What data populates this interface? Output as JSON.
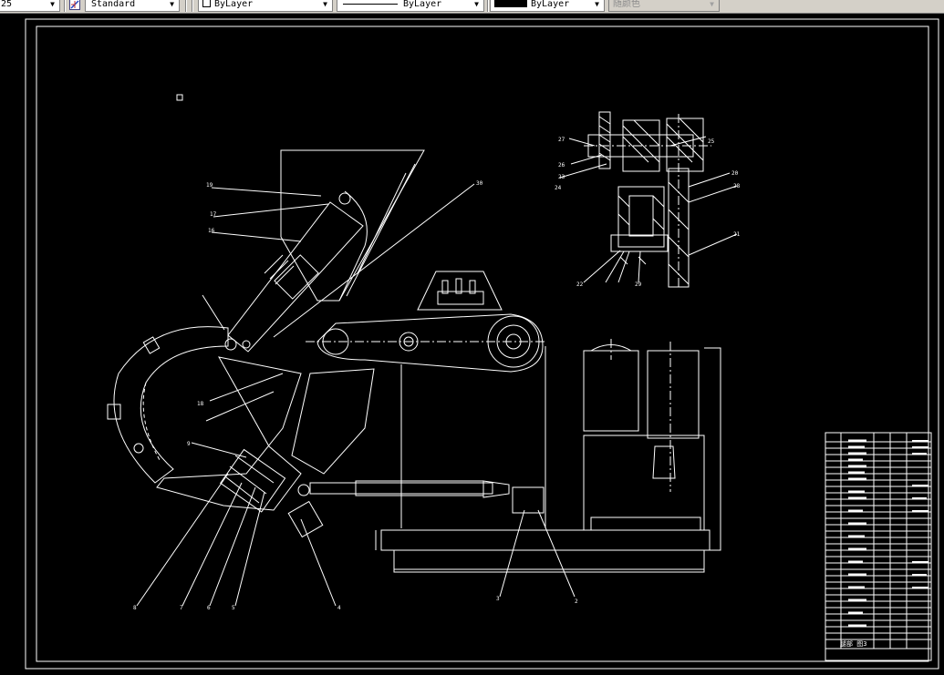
{
  "toolbar": {
    "text_style_fragment": "25",
    "dim_style": "Standard",
    "layer": "ByLayer",
    "linetype": "ByLayer",
    "lineweight": "ByLayer",
    "plot_style": "随颜色"
  },
  "drawing": {
    "part_labels": {
      "l16": "16",
      "l17": "17",
      "l18": "18",
      "l19": "19",
      "l20": "20",
      "l30": "30",
      "l9": "9",
      "l8": "8",
      "l7": "7",
      "l6": "6",
      "l5": "5",
      "l4": "4",
      "l3": "3",
      "l2": "2",
      "l21": "21",
      "l22": "22",
      "l23": "23",
      "l24": "24",
      "l25": "25",
      "l26": "26",
      "l27": "27",
      "l28": "28",
      "l29": "29"
    },
    "title_block": {
      "name_cell": "腿部 图3"
    }
  },
  "colors": {
    "toolbar_bg": "#d4d0c8",
    "canvas_bg": "#000000",
    "line": "#ffffff"
  }
}
